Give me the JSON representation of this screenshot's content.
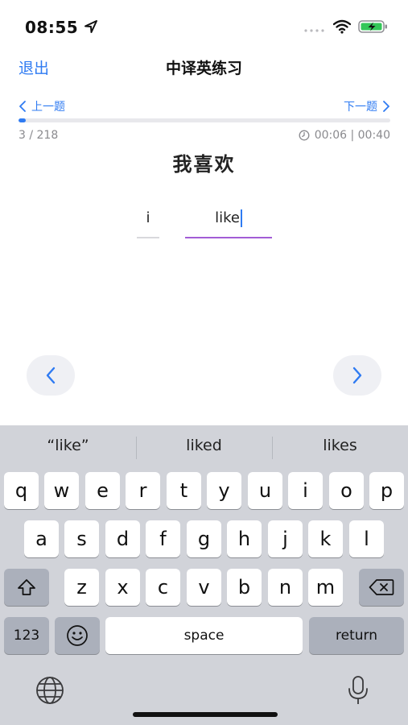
{
  "status_bar": {
    "time": "08:55",
    "icons": [
      "location-arrow-icon",
      "signal-dots-icon",
      "wifi-icon",
      "battery-charging-icon"
    ],
    "battery_color": "#34c759"
  },
  "nav": {
    "back_label": "退出",
    "title": "中译英练习"
  },
  "pager": {
    "prev_label": "上一题",
    "next_label": "下一题"
  },
  "progress": {
    "current": 3,
    "total": 218,
    "label": "3 / 218",
    "fraction": 0.014
  },
  "timer": {
    "label": "00:06 | 00:40",
    "icon": "clock-icon"
  },
  "question": {
    "chinese": "我喜欢",
    "answer_words": [
      "i",
      "like"
    ]
  },
  "buttons": {
    "prev_icon": "chevron-left-icon",
    "next_icon": "chevron-right-icon"
  },
  "keyboard": {
    "suggestions": [
      "“like”",
      "liked",
      "likes"
    ],
    "row1": [
      "q",
      "w",
      "e",
      "r",
      "t",
      "y",
      "u",
      "i",
      "o",
      "p"
    ],
    "row2": [
      "a",
      "s",
      "d",
      "f",
      "g",
      "h",
      "j",
      "k",
      "l"
    ],
    "row3": [
      "z",
      "x",
      "c",
      "v",
      "b",
      "n",
      "m"
    ],
    "numbers_label": "123",
    "space_label": "space",
    "return_label": "return",
    "icons": [
      "shift-icon",
      "backspace-icon",
      "emoji-icon",
      "globe-icon",
      "microphone-icon"
    ]
  },
  "colors": {
    "accent": "#2f7bf2",
    "active_underline": "#a25cd6",
    "keyboard_bg": "#d1d3d9",
    "special_key": "#abb0bb"
  }
}
